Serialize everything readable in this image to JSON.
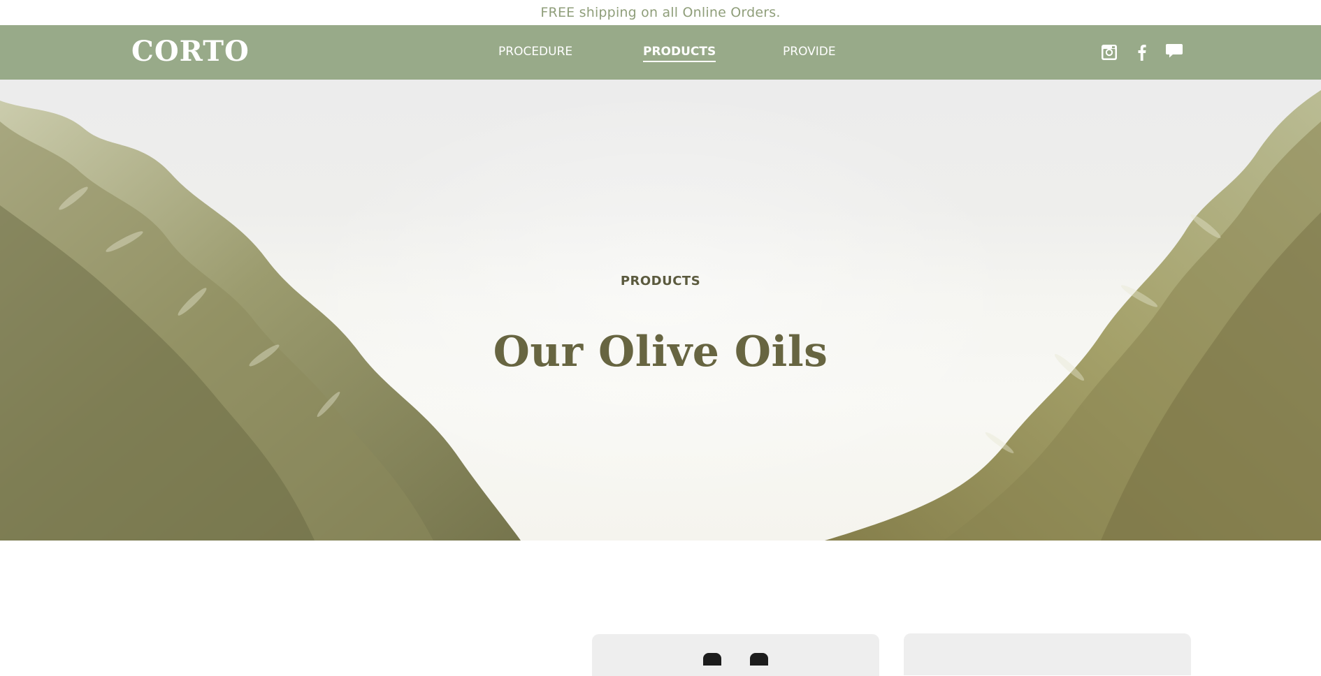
{
  "announcement": {
    "text": "FREE shipping on all Online Orders."
  },
  "header": {
    "logo": "CORTO",
    "nav": [
      {
        "label": "PROCEDURE",
        "active": false
      },
      {
        "label": "PRODUCTS",
        "active": true
      },
      {
        "label": "PROVIDE",
        "active": false
      }
    ],
    "social_icons": [
      "instagram-icon",
      "facebook-icon",
      "chat-icon"
    ]
  },
  "hero": {
    "kicker": "PRODUCTS",
    "title": "Our Olive Oils"
  },
  "products": {
    "cards": [
      {
        "image": "olive-oil-bottles"
      },
      {
        "image": "product-image"
      }
    ]
  },
  "colors": {
    "nav_background": "#98aa89",
    "announcement_text": "#8f9e7a",
    "hero_title": "#676541",
    "hero_kicker": "#5b5a3e",
    "card_background": "#eeeeee"
  }
}
